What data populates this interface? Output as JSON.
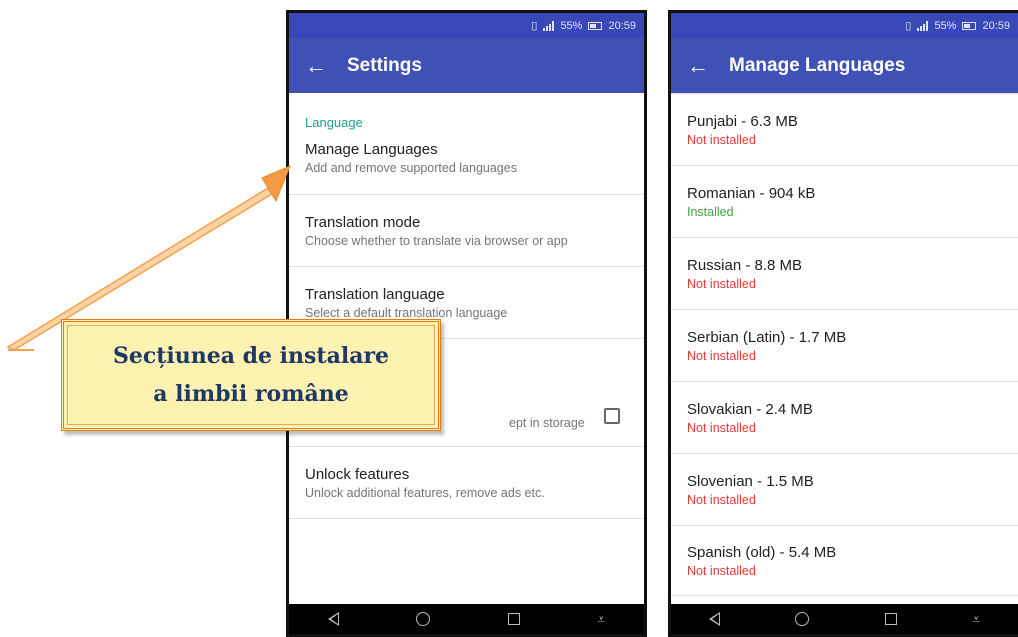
{
  "status_bar": {
    "vibrate_icon": "vibrate-icon",
    "signal_icon": "signal-icon",
    "battery_percent": "55%",
    "time": "20:59"
  },
  "settings_screen": {
    "back_icon": "back-arrow-icon",
    "title": "Settings",
    "section_label": "Language",
    "items": [
      {
        "title": "Manage Languages",
        "subtitle": "Add and remove supported languages"
      },
      {
        "title": "Translation mode",
        "subtitle": "Choose whether to translate via browser or app"
      },
      {
        "title": "Translation language",
        "subtitle": "Select a default translation language"
      },
      {
        "title": "",
        "subtitle": "ept in storage",
        "has_checkbox": true,
        "checked": false
      },
      {
        "title": "Unlock features",
        "subtitle": "Unlock additional features, remove ads etc."
      }
    ]
  },
  "languages_screen": {
    "back_icon": "back-arrow-icon",
    "title": "Manage Languages",
    "languages": [
      {
        "name": "Punjabi - 6.3 MB",
        "status": "Not installed"
      },
      {
        "name": "Romanian - 904 kB",
        "status": "Installed"
      },
      {
        "name": "Russian - 8.8 MB",
        "status": "Not installed"
      },
      {
        "name": "Serbian (Latin) - 1.7 MB",
        "status": "Not installed"
      },
      {
        "name": "Slovakian - 2.4 MB",
        "status": "Not installed"
      },
      {
        "name": "Slovenian - 1.5 MB",
        "status": "Not installed"
      },
      {
        "name": "Spanish (old) - 5.4 MB",
        "status": "Not installed"
      }
    ]
  },
  "nav_bar": {
    "icons": [
      "back-triangle-icon",
      "home-circle-icon",
      "recents-square-icon",
      "notification-down-icon"
    ]
  },
  "callout": {
    "line1": "Secțiunea de instalare",
    "line2": "a limbii române"
  },
  "colors": {
    "status_bar": "#3948b7",
    "app_bar": "#3f51b5",
    "section_label": "#1f9e8c",
    "not_installed": "#e53935",
    "installed": "#43a047",
    "callout_fill": "#fdf2b2",
    "callout_border": "#e07d18",
    "callout_text": "#1f3864",
    "arrow": "#f4a04c"
  }
}
